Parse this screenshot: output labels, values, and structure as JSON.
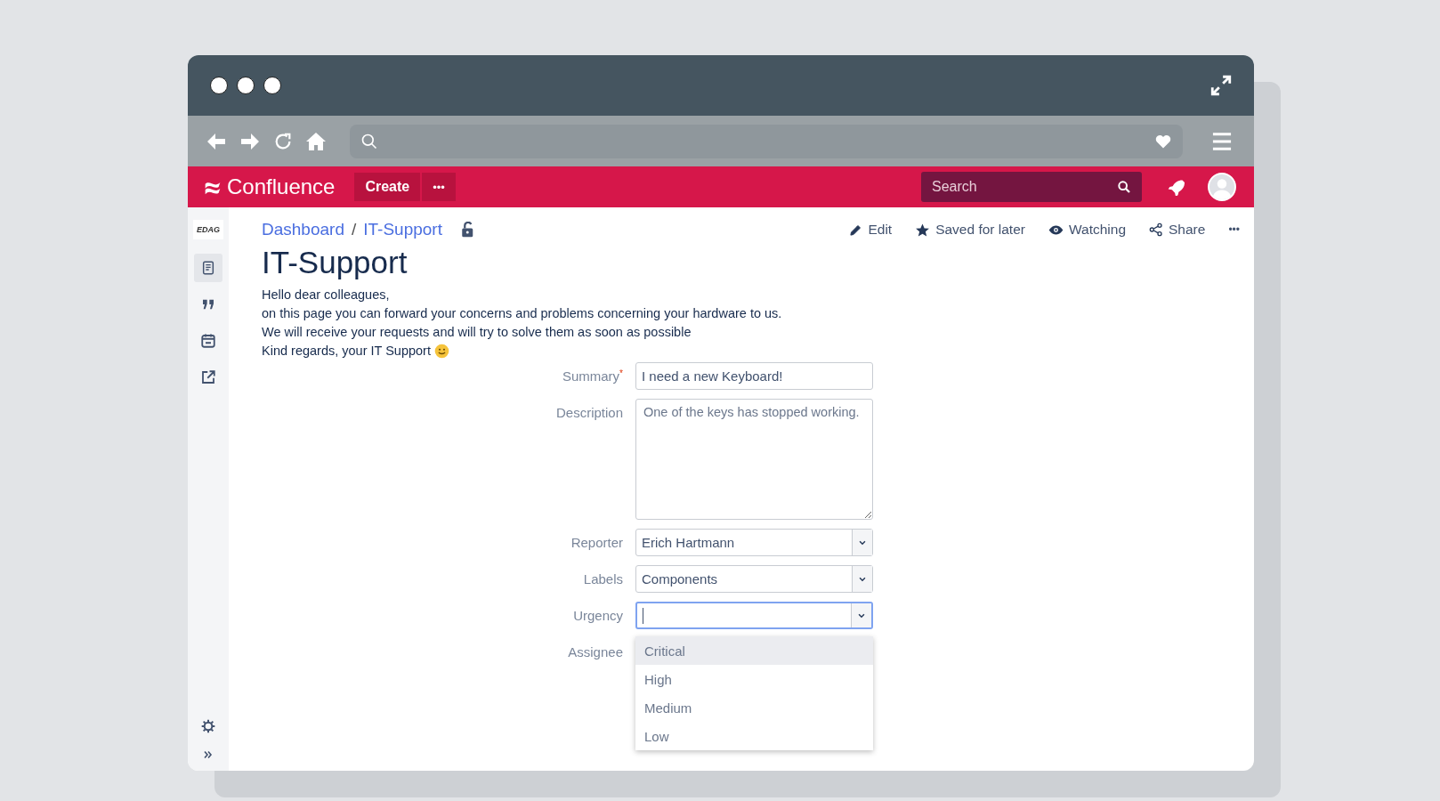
{
  "app_bar": {
    "logo": "Confluence",
    "create": "Create",
    "more": "•••",
    "search": {
      "placeholder": "Search"
    }
  },
  "sidebar": {
    "logo": "EDAG",
    "items": [
      {
        "kind": "pages",
        "selected": true
      },
      {
        "kind": "quote",
        "selected": false
      },
      {
        "kind": "calendar",
        "selected": false
      },
      {
        "kind": "export",
        "selected": false
      }
    ],
    "bottom": [
      {
        "kind": "settings"
      },
      {
        "kind": "collapse"
      }
    ]
  },
  "breadcrumbs": [
    "Dashboard",
    "IT-Support"
  ],
  "breadcrumb_separator": "/",
  "page_actions": [
    {
      "kind": "edit",
      "label": "Edit"
    },
    {
      "kind": "saved",
      "label": "Saved for later"
    },
    {
      "kind": "watch",
      "label": "Watching"
    },
    {
      "kind": "share",
      "label": "Share"
    },
    {
      "kind": "more",
      "label": "•••"
    }
  ],
  "title": "IT-Support",
  "body": [
    "Hello dear colleagues,",
    "on this page you can forward your concerns and problems concerning your hardware to us.",
    "We will receive your requests and will try to solve them as soon as possible",
    "Kind regards, your IT Support"
  ],
  "form": {
    "fields": [
      {
        "label": "Summary",
        "required_mark": "*",
        "kind": "text",
        "value": "I need a new Keyboard!"
      },
      {
        "label": "Description",
        "kind": "textarea",
        "value": "One of the keys has stopped working."
      },
      {
        "label": "Reporter",
        "kind": "select",
        "value": "Erich Hartmann"
      },
      {
        "label": "Labels",
        "kind": "select",
        "value": "Components"
      },
      {
        "label": "Urgency",
        "kind": "select",
        "focused": true,
        "options": [
          {
            "label": "Critical",
            "selected": true
          },
          {
            "label": "High",
            "selected": false
          },
          {
            "label": "Medium",
            "selected": false
          },
          {
            "label": "Low",
            "selected": false
          }
        ]
      },
      {
        "label": "Assignee"
      }
    ]
  }
}
